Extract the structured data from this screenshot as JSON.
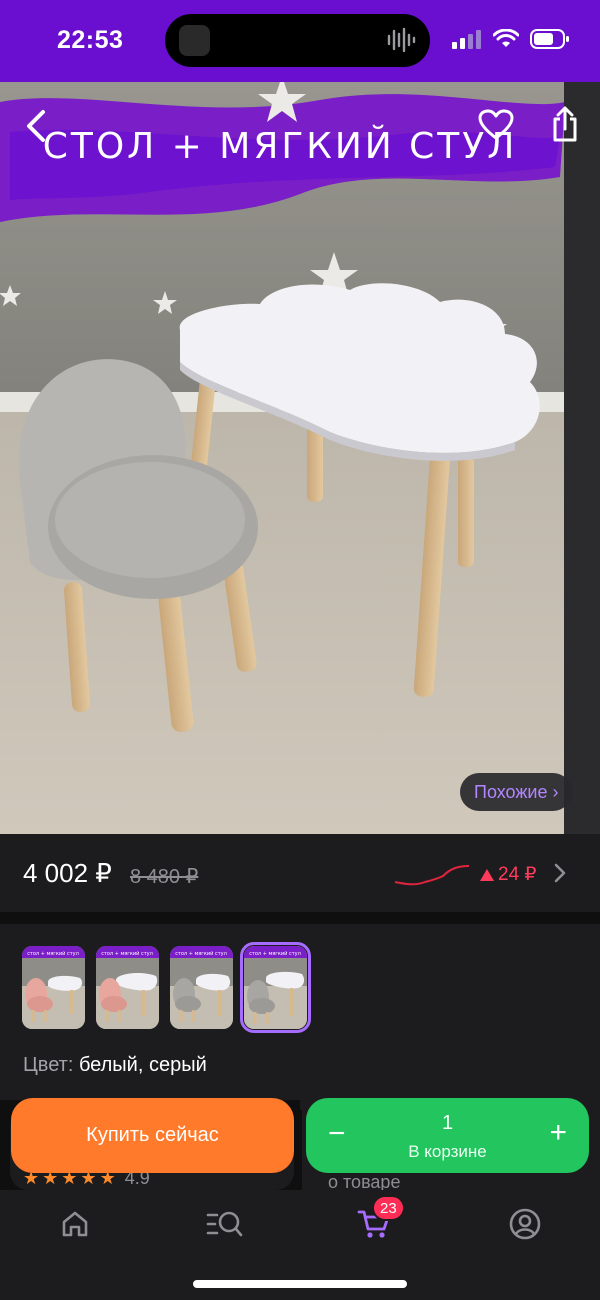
{
  "status_bar": {
    "time": "22:53",
    "bg_color": "#6a0fd0",
    "icons": [
      "signal-icon",
      "wifi-icon",
      "battery-icon"
    ]
  },
  "hero": {
    "banner_text": "СТОЛ + МЯГКИЙ СТУЛ",
    "back_icon": "chevron-left-icon",
    "favorite_icon": "heart-icon",
    "share_icon": "share-icon",
    "similar_label": "Похожие ›"
  },
  "price": {
    "current": "4 002 ₽",
    "old": "8 480 ₽",
    "change": "24 ₽",
    "change_color": "#ff3b5c"
  },
  "variants": {
    "thumbnails": [
      {
        "chair_color": "pink",
        "selected": false
      },
      {
        "chair_color": "pink",
        "selected": false
      },
      {
        "chair_color": "grey",
        "selected": false
      },
      {
        "chair_color": "grey",
        "selected": true
      }
    ],
    "thumb_banner": "стол + мягкий стул",
    "color_label": "Цвет:",
    "color_value": "белый, серый"
  },
  "below": {
    "rating": "4.9",
    "about": "о товаре"
  },
  "actions": {
    "buy_label": "Купить сейчас",
    "buy_color": "#ff7a2b",
    "cart_qty": "1",
    "cart_sub": "В корзине",
    "cart_minus": "−",
    "cart_plus": "+",
    "cart_color": "#22c55e"
  },
  "nav": {
    "items": [
      "home-icon",
      "catalog-search-icon",
      "cart-icon",
      "profile-icon"
    ],
    "active": "cart-icon",
    "cart_badge": "23",
    "accent": "#a56cff"
  }
}
